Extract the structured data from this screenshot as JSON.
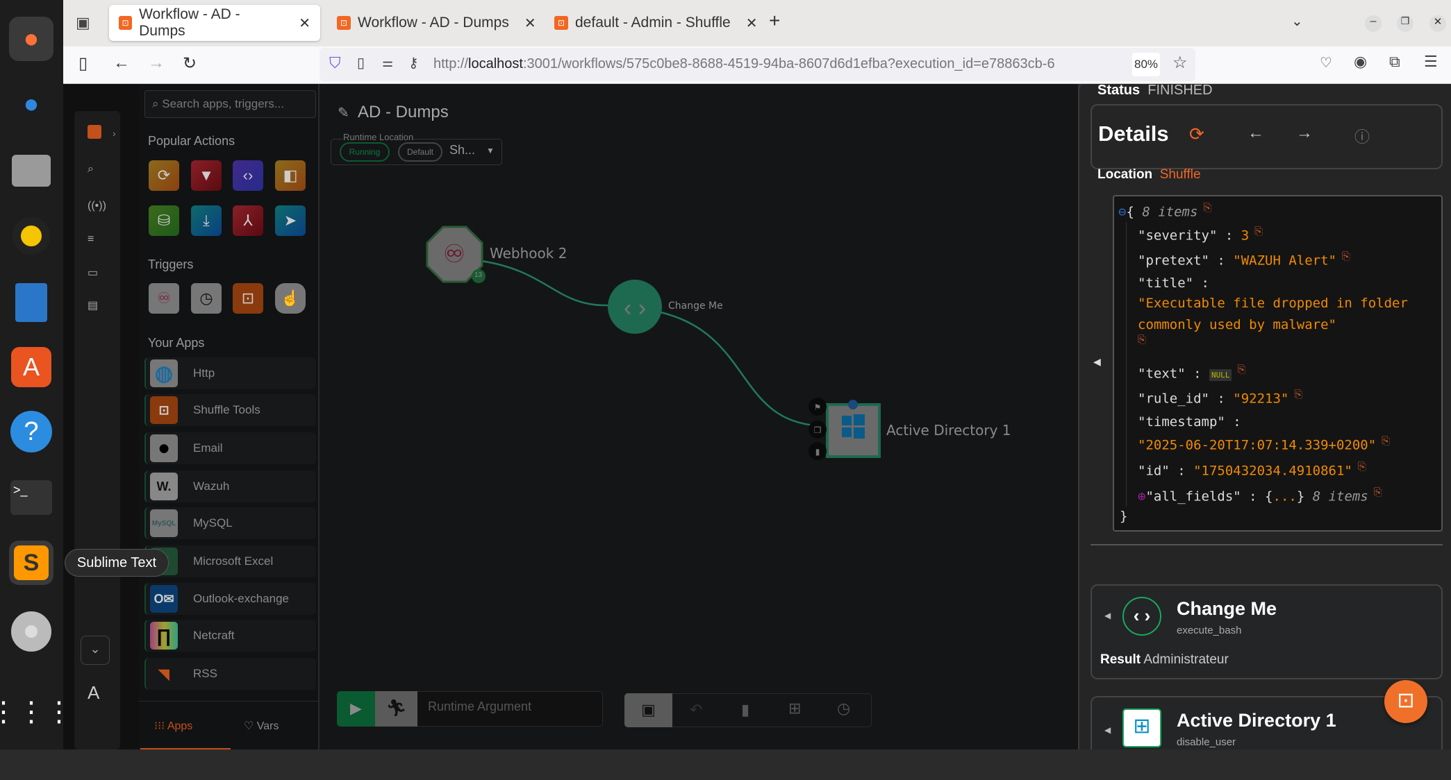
{
  "dock": {
    "tooltip": "Sublime Text",
    "items": [
      "firefox",
      "thunderbird",
      "files",
      "rhythmbox",
      "writer",
      "app-center",
      "help",
      "terminal",
      "sublime-text",
      "dvd",
      "show-apps"
    ]
  },
  "browser": {
    "tabs": [
      {
        "label": "Workflow - AD - Dumps",
        "active": true
      },
      {
        "label": "Workflow - AD - Dumps"
      },
      {
        "label": "default - Admin - Shuffle"
      }
    ],
    "url_prefix": "http://",
    "url_host": "localhost",
    "url_rest": ":3001/workflows/575c0be8-8688-4519-94ba-8607d6d1efba?execution_id=e78863cb-6",
    "zoom": "80%"
  },
  "sidebar": {
    "search_placeholder": "Search apps, triggers...",
    "popular_actions_title": "Popular Actions",
    "triggers_title": "Triggers",
    "your_apps_title": "Your Apps",
    "apps": [
      "Http",
      "Shuffle Tools",
      "Email",
      "Wazuh",
      "MySQL",
      "Microsoft Excel",
      "Outlook-exchange",
      "Netcraft",
      "RSS"
    ],
    "tab_apps": "Apps",
    "tab_vars": "Vars",
    "avatar": "A"
  },
  "workflow": {
    "name": "AD - Dumps",
    "runtime_label": "Runtime Location",
    "chip_running": "Running",
    "chip_default": "Default",
    "runtime_value": "Sh...",
    "nodes": {
      "webhook": "Webhook 2",
      "webhook_badge": "13",
      "change_me": "Change Me",
      "ad": "Active Directory 1"
    },
    "runtime_argument_placeholder": "Runtime Argument"
  },
  "panel": {
    "status_label": "Status",
    "status_value": "FINISHED",
    "details_title": "Details",
    "location_label": "Location",
    "location_value": "Shuffle",
    "json": {
      "items_count": "8 items",
      "severity": "3",
      "pretext": "\"WAZUH Alert\"",
      "title_1": "\"Executable file dropped in folder",
      "title_2": "commonly used by malware\"",
      "text": "NULL",
      "rule_id": "\"92213\"",
      "timestamp": "\"2025-06-20T17:07:14.339+0200\"",
      "id": "\"1750432034.4910861\"",
      "all_fields_count": "8 items",
      "k_severity": "\"severity\"",
      "k_pretext": "\"pretext\"",
      "k_title": "\"title\"",
      "k_text": "\"text\"",
      "k_rule_id": "\"rule_id\"",
      "k_timestamp": "\"timestamp\"",
      "k_id": "\"id\"",
      "k_all_fields": "\"all_fields\""
    },
    "results": [
      {
        "name": "Change Me",
        "action": "execute_bash",
        "result_label": "Result",
        "result_value": "Administrateur"
      },
      {
        "name": "Active Directory 1",
        "action": "disable_user"
      }
    ]
  },
  "colors": {
    "accent": "#f26722",
    "green": "#1f7a5a",
    "json_value": "#f08a00"
  }
}
